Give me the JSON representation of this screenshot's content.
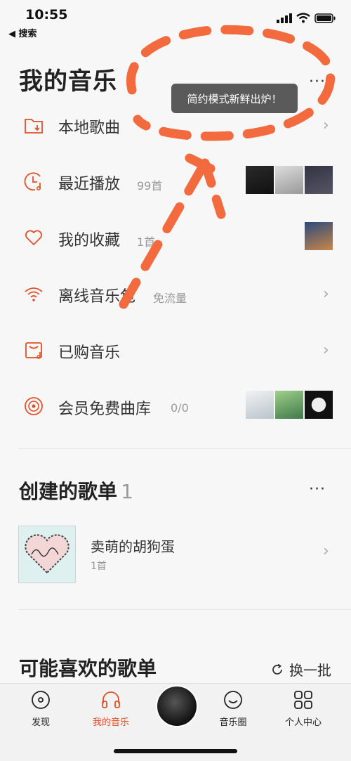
{
  "status": {
    "time": "10:55",
    "back_app": "◀ 搜索"
  },
  "page_title": "我的音乐",
  "more_label": "···",
  "tooltip": "简约模式新鲜出炉！",
  "rows": [
    {
      "label": "本地歌曲",
      "sub": "",
      "icon": "folder-download-icon"
    },
    {
      "label": "最近播放",
      "sub": "99首",
      "icon": "clock-music-icon"
    },
    {
      "label": "我的收藏",
      "sub": "1首",
      "icon": "heart-icon"
    },
    {
      "label": "离线音乐包",
      "sub": "免流量",
      "icon": "wifi-icon"
    },
    {
      "label": "已购音乐",
      "sub": "",
      "icon": "purchased-music-icon"
    },
    {
      "label": "会员免费曲库",
      "sub": "0/0",
      "icon": "vinyl-disc-icon"
    }
  ],
  "created_section": {
    "title": "创建的歌单",
    "count": "1"
  },
  "playlist": {
    "name": "卖萌的胡狗蛋",
    "count": "1首"
  },
  "recommend_section": {
    "title": "可能喜欢的歌单",
    "refresh_label": "换一批"
  },
  "tabs": [
    {
      "label": "发现",
      "icon": "disc-icon"
    },
    {
      "label": "我的音乐",
      "icon": "headphones-icon"
    },
    {
      "label": "",
      "icon": "now-playing-album"
    },
    {
      "label": "音乐圈",
      "icon": "smile-icon"
    },
    {
      "label": "个人中心",
      "icon": "grid-icon"
    }
  ],
  "colors": {
    "accent": "#e04f28",
    "annotation": "#f26a3d"
  }
}
